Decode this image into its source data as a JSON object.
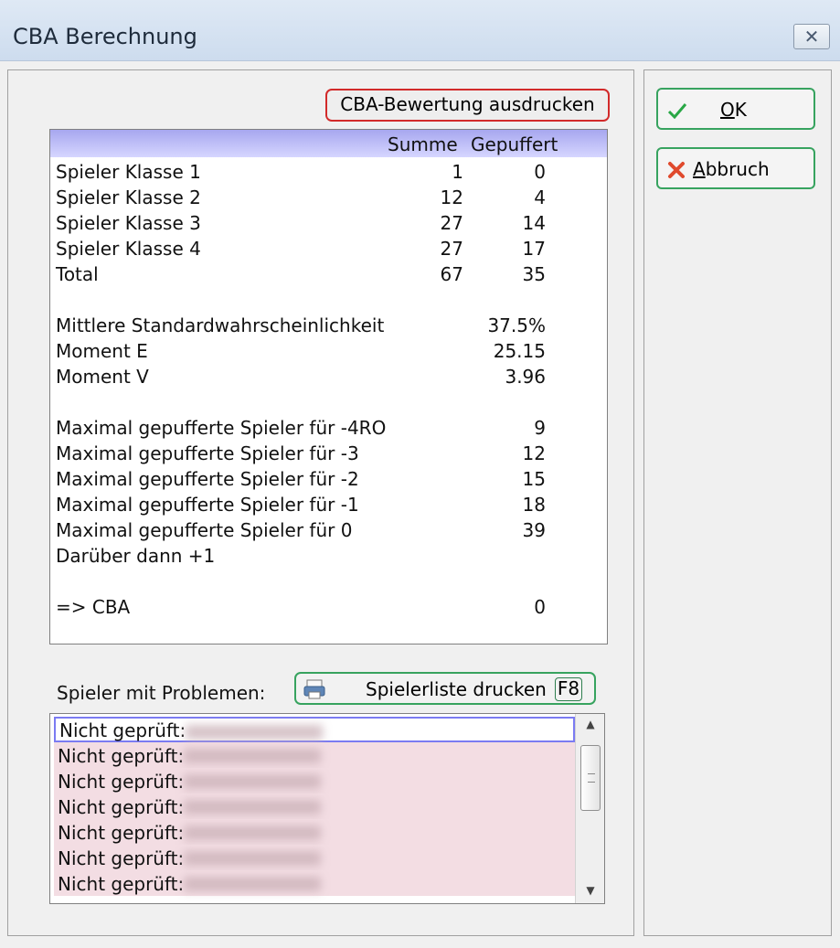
{
  "window": {
    "title": "CBA Berechnung",
    "close_glyph": "✕"
  },
  "buttons": {
    "print_evaluation": "CBA-Bewertung ausdrucken",
    "ok": "OK",
    "ok_mnemonic": "O",
    "ok_rest": "K",
    "cancel": "Abbruch",
    "cancel_mnemonic": "A",
    "cancel_rest": "bbruch",
    "print_player_list": "Spielerliste drucken",
    "print_player_list_key": "F8"
  },
  "stats": {
    "headers": {
      "sum": "Summe",
      "buffered": "Gepuffert"
    },
    "class_rows": [
      {
        "label": "Spieler Klasse 1",
        "sum": "1",
        "buffered": "0"
      },
      {
        "label": "Spieler Klasse 2",
        "sum": "12",
        "buffered": "4"
      },
      {
        "label": "Spieler Klasse 3",
        "sum": "27",
        "buffered": "14"
      },
      {
        "label": "Spieler Klasse 4",
        "sum": "27",
        "buffered": "17"
      },
      {
        "label": "Total",
        "sum": "67",
        "buffered": "35"
      }
    ],
    "probability_rows": [
      {
        "label": "Mittlere Standardwahrscheinlichkeit",
        "value": "37.5%"
      },
      {
        "label": "Moment E",
        "value": "25.15"
      },
      {
        "label": "Moment V",
        "value": "3.96"
      }
    ],
    "buffer_rows": [
      {
        "label": "Maximal gepufferte Spieler für -4RO",
        "value": "9"
      },
      {
        "label": "Maximal gepufferte Spieler für -3",
        "value": "12"
      },
      {
        "label": "Maximal gepufferte Spieler für -2",
        "value": "15"
      },
      {
        "label": "Maximal gepufferte Spieler für -1",
        "value": "18"
      },
      {
        "label": "Maximal gepufferte Spieler für 0",
        "value": "39"
      }
    ],
    "above_note": "Darüber dann +1",
    "cba_row": {
      "label": "=> CBA",
      "value": "0"
    }
  },
  "problems": {
    "label": "Spieler mit Problemen:",
    "items": [
      "Nicht geprüft:",
      "Nicht geprüft:",
      "Nicht geprüft:",
      "Nicht geprüft:",
      "Nicht geprüft:",
      "Nicht geprüft:",
      "Nicht geprüft:"
    ]
  },
  "colors": {
    "accent_green": "#37a35f",
    "highlight_red": "#d22a2a",
    "header_blue": "#a7a7ef",
    "row_pink": "#f3dde3"
  },
  "icons": {
    "ok": "checkmark-icon",
    "cancel": "x-icon",
    "printer": "printer-icon",
    "scroll_grip": "grip-icon"
  }
}
